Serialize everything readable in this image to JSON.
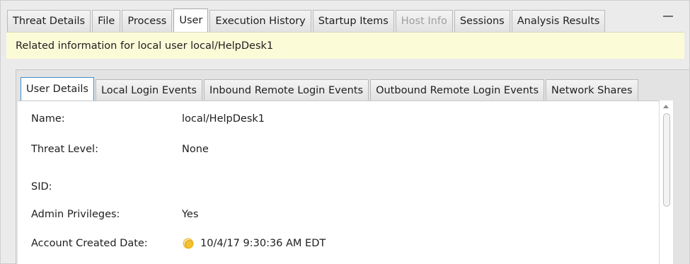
{
  "top_tabs": [
    {
      "label": "Threat Details",
      "state": "normal"
    },
    {
      "label": "File",
      "state": "normal"
    },
    {
      "label": "Process",
      "state": "normal"
    },
    {
      "label": "User",
      "state": "active"
    },
    {
      "label": "Execution History",
      "state": "normal"
    },
    {
      "label": "Startup Items",
      "state": "normal"
    },
    {
      "label": "Host Info",
      "state": "disabled"
    },
    {
      "label": "Sessions",
      "state": "normal"
    },
    {
      "label": "Analysis Results",
      "state": "normal"
    }
  ],
  "banner": {
    "text": "Related information for local user local/HelpDesk1",
    "color": "#fcfbd8"
  },
  "inner_tabs": [
    {
      "label": "User Details",
      "state": "active"
    },
    {
      "label": "Local Login Events",
      "state": "normal"
    },
    {
      "label": "Inbound Remote Login Events",
      "state": "normal"
    },
    {
      "label": "Outbound Remote Login Events",
      "state": "normal"
    },
    {
      "label": "Network Shares",
      "state": "normal"
    }
  ],
  "details": [
    {
      "label": "Name:",
      "value": "local/HelpDesk1"
    },
    {
      "label": "Threat Level:",
      "value": "None"
    },
    {
      "label": "SID:",
      "value": ""
    },
    {
      "label": "Admin Privileges:",
      "value": "Yes"
    },
    {
      "label": "Account Created Date:",
      "value": "10/4/17 9:30:36 AM EDT",
      "icon": "sun-icon"
    }
  ],
  "accent_color": "#3c8fd0"
}
